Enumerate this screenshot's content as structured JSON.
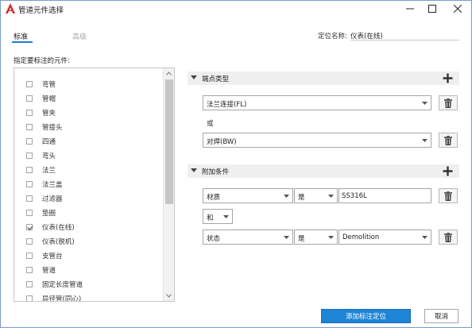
{
  "window": {
    "title": "管道元件选择",
    "app_icon": "autocad-a-icon",
    "brand_color": "#d42a2a"
  },
  "tabs": [
    {
      "label": "标准",
      "active": true
    },
    {
      "label": "高级",
      "active": false
    }
  ],
  "location": {
    "label": "定位名称:",
    "value": "仪表(在线)"
  },
  "component_list": {
    "caption": "指定要标注的元件:",
    "items": [
      {
        "label": "弯管",
        "checked": false
      },
      {
        "label": "管帽",
        "checked": false
      },
      {
        "label": "管夹",
        "checked": false
      },
      {
        "label": "管接头",
        "checked": false
      },
      {
        "label": "四通",
        "checked": false
      },
      {
        "label": "弯头",
        "checked": false
      },
      {
        "label": "法兰",
        "checked": false
      },
      {
        "label": "法兰盖",
        "checked": false
      },
      {
        "label": "过滤器",
        "checked": false
      },
      {
        "label": "垫圈",
        "checked": false
      },
      {
        "label": "仪表(在线)",
        "checked": true
      },
      {
        "label": "仪表(脱机)",
        "checked": false
      },
      {
        "label": "支管台",
        "checked": false
      },
      {
        "label": "管道",
        "checked": false
      },
      {
        "label": "固定长度管道",
        "checked": false
      },
      {
        "label": "异径管(同心)",
        "checked": false
      }
    ]
  },
  "endpoint_section": {
    "title": "端点类型",
    "first_value": "法兰连接(FL)",
    "or_label": "或",
    "second_value": "对焊(BW)"
  },
  "condition_section": {
    "title": "附加条件",
    "row1": {
      "property": "材质",
      "operator": "是",
      "value": "SS316L"
    },
    "logic": "和",
    "row2": {
      "property": "状态",
      "operator": "是",
      "value": "Demolition"
    }
  },
  "buttons": {
    "primary": "添加标注定位",
    "cancel": "取消"
  },
  "colors": {
    "accent": "#1d84d6",
    "section_bg": "#efefef"
  }
}
